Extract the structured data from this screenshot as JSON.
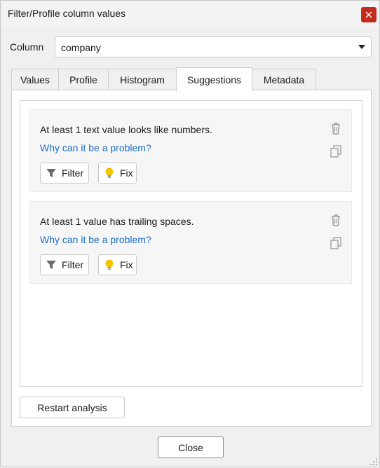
{
  "window": {
    "title": "Filter/Profile column values"
  },
  "column": {
    "label": "Column",
    "value": "company"
  },
  "tabs": [
    {
      "label": "Values"
    },
    {
      "label": "Profile"
    },
    {
      "label": "Histogram"
    },
    {
      "label": "Suggestions",
      "active": true
    },
    {
      "label": "Metadata"
    }
  ],
  "suggestions": [
    {
      "message": "At least 1 text value looks like numbers.",
      "link": "Why can it be a problem?",
      "filter_label": "Filter",
      "fix_label": "Fix"
    },
    {
      "message": "At least 1 value has trailing spaces.",
      "link": "Why can it be a problem?",
      "filter_label": "Filter",
      "fix_label": "Fix"
    }
  ],
  "buttons": {
    "restart": "Restart analysis",
    "close": "Close"
  },
  "colors": {
    "link": "#1b6ec2",
    "close_hover": "#c42b1c",
    "bulb": "#f5c400"
  }
}
